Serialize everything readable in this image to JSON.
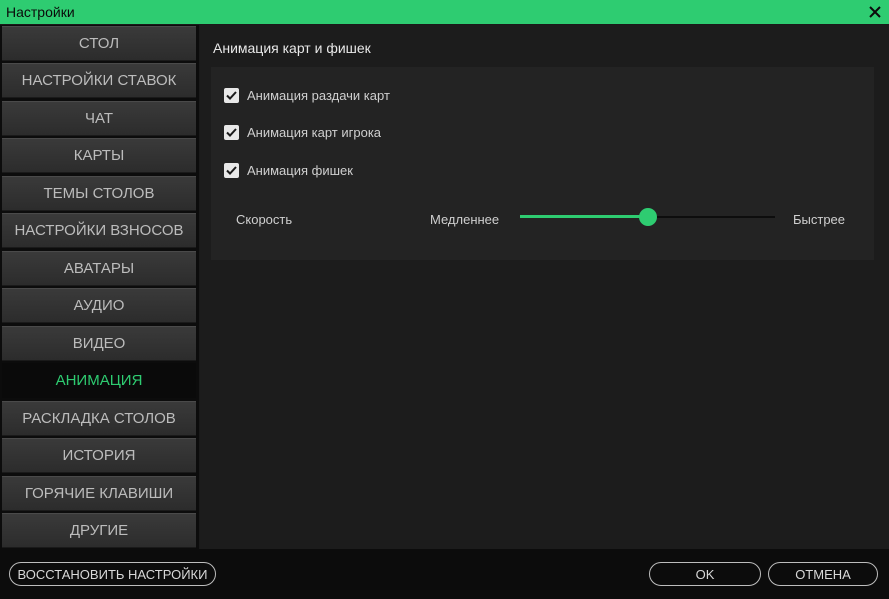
{
  "window": {
    "title": "Настройки"
  },
  "sidebar": {
    "items": [
      {
        "label": "СТОЛ",
        "active": false
      },
      {
        "label": "НАСТРОЙКИ СТАВОК",
        "active": false
      },
      {
        "label": "ЧАТ",
        "active": false
      },
      {
        "label": "КАРТЫ",
        "active": false
      },
      {
        "label": "ТЕМЫ СТОЛОВ",
        "active": false
      },
      {
        "label": "НАСТРОЙКИ ВЗНОСОВ",
        "active": false
      },
      {
        "label": "АВАТАРЫ",
        "active": false
      },
      {
        "label": "АУДИО",
        "active": false
      },
      {
        "label": "ВИДЕО",
        "active": false
      },
      {
        "label": "АНИМАЦИЯ",
        "active": true
      },
      {
        "label": "РАСКЛАДКА СТОЛОВ",
        "active": false
      },
      {
        "label": "ИСТОРИЯ",
        "active": false
      },
      {
        "label": "ГОРЯЧИЕ КЛАВИШИ",
        "active": false
      },
      {
        "label": "ДРУГИЕ",
        "active": false
      }
    ]
  },
  "main": {
    "section_title": "Анимация карт и фишек",
    "checkboxes": [
      {
        "label": "Анимация раздачи карт",
        "checked": true
      },
      {
        "label": "Анимация карт игрока",
        "checked": true
      },
      {
        "label": "Анимация фишек",
        "checked": true
      }
    ],
    "speed": {
      "label": "Скорость",
      "min_label": "Медленнее",
      "max_label": "Быстрее",
      "value_fraction": 0.5
    }
  },
  "footer": {
    "restore_label": "ВОССТАНОВИТЬ НАСТРОЙКИ",
    "ok_label": "OK",
    "cancel_label": "ОТМЕНА"
  },
  "colors": {
    "accent": "#2ecc71",
    "background": "#1c1c1c",
    "panel": "#232323",
    "nav_button": "#333333"
  },
  "icons": {
    "close": "close-icon",
    "check": "checkmark-icon"
  }
}
